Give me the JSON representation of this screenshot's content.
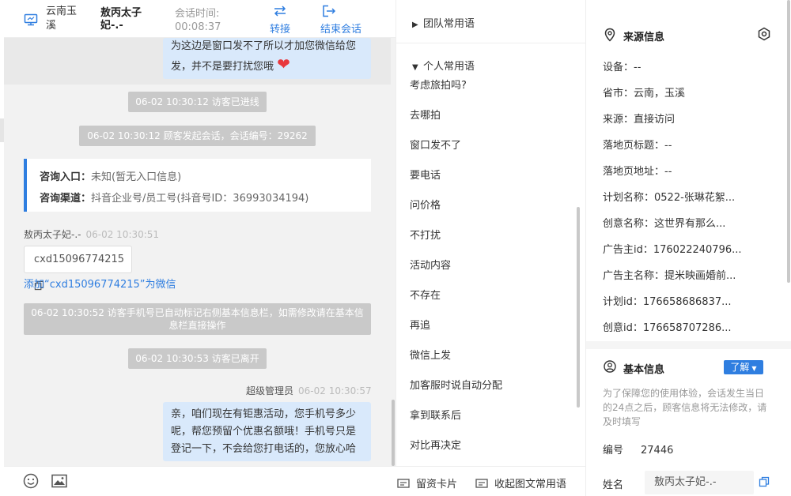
{
  "header": {
    "location": "云南玉溪",
    "visitor_name": "敖丙太子妃-.-",
    "time_label": "会话时间:",
    "time_value": "00:08:37",
    "transfer_label": "转接",
    "end_label": "结束会话"
  },
  "chat": {
    "msg1": "为这边是窗口发不了所以才加您微信给您发，并不是要打扰您哦",
    "sys_visitor_entered": "06-02 10:30:12 访客已进线",
    "sys_session_start": "06-02 10:30:12 顾客发起会话，会话编号：29262",
    "entry_label": "咨询入口：",
    "entry_value": "未知(暂无入口信息)",
    "channel_label": "咨询渠道：",
    "channel_value": "抖音企业号/员工号(抖音号ID：36993034194)",
    "visitor_sender": "敖丙太子妃-.-",
    "visitor_time": "06-02 10:30:51",
    "wechat_id": "cxd15096774215",
    "add_wechat_link": "添加“cxd15096774215”为微信",
    "sys_phone_marked": "06-02 10:30:52 访客手机号已自动标记右侧基本信息栏，如需修改请在基本信息栏直接操作",
    "sys_left": "06-02 10:30:53 访客已离开",
    "agent_sender": "超级管理员",
    "agent_time": "06-02 10:30:57",
    "msg2": "亲，咱们现在有钜惠活动，您手机号多少呢，帮您预留个优惠名额哦！手机号只是登记一下，不会给您打电话的，您放心哈"
  },
  "toolbar": {
    "card_label": "留资卡片",
    "phrase_label": "收起图文常用语"
  },
  "phrases": {
    "team_group": "团队常用语",
    "personal_group": "个人常用语",
    "items": [
      "考虑旅拍吗?",
      "去哪拍",
      "窗口发不了",
      "要电话",
      "问价格",
      "不打扰",
      "活动内容",
      "不存在",
      "再追",
      "微信上发",
      "加客服时说自动分配",
      "拿到联系后",
      "对比再决定"
    ]
  },
  "source": {
    "title": "来源信息",
    "fields": [
      "设备：--",
      "省市：云南，玉溪",
      "来源：直接访问",
      "落地页标题：--",
      "落地页地址：--",
      "计划名称：0522-张琳花絮...",
      "创意名称：这世界有那么...",
      "广告主id：176022240796...",
      "广告主名称：提米映画婚前...",
      "计划id：176658686837...",
      "创意id：176658707286..."
    ]
  },
  "basic": {
    "title": "基本信息",
    "learn_label": "了解",
    "note": "为了保障您的使用体验，会话发生当日的24点之后，顾客信息将无法修改，请及时填写",
    "number_label": "编号",
    "number_value": "27446",
    "name_label": "姓名",
    "name_value": "敖丙太子妃-.-"
  },
  "icons": {
    "accent": "#2f7ee0",
    "heart": "#e8383d"
  }
}
